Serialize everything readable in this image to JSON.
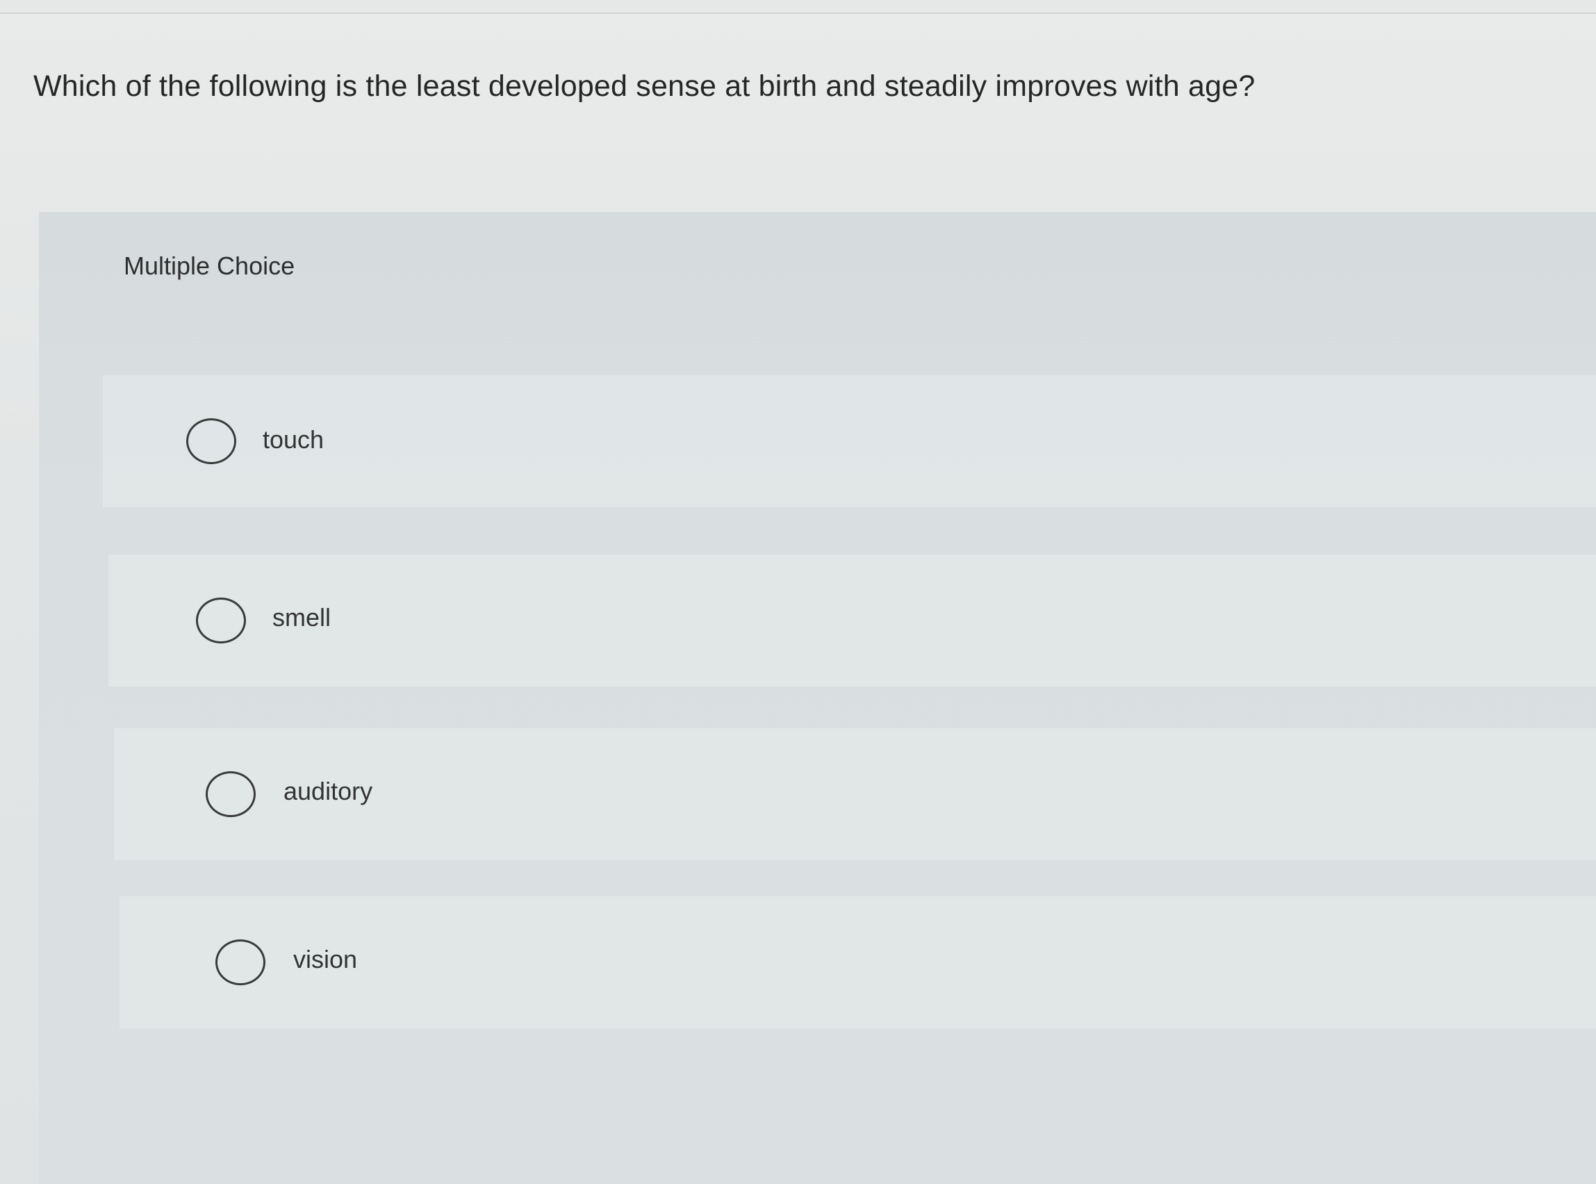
{
  "question": {
    "text": "Which of the following is the least developed sense at birth and steadily improves with age?"
  },
  "multiple_choice": {
    "label": "Multiple Choice",
    "options": [
      {
        "label": "touch",
        "selected": false
      },
      {
        "label": "smell",
        "selected": false
      },
      {
        "label": "auditory",
        "selected": false
      },
      {
        "label": "vision",
        "selected": false
      }
    ]
  },
  "colors": {
    "background": "#e6e8e8",
    "panel": "#d9dfe1",
    "text": "#2b2b2b",
    "radio_border": "#3a3a3a"
  }
}
